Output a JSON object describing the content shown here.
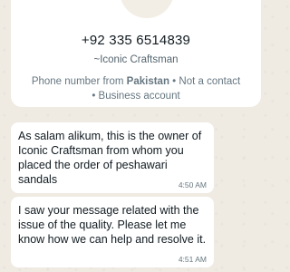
{
  "contact": {
    "phone": "+92 335 6514839",
    "push_name": "~Iconic Craftsman",
    "meta_prefix": "Phone number from ",
    "meta_country": "Pakistan",
    "meta_suffix": " • Not a contact • Business account"
  },
  "messages": [
    {
      "text": "As salam alikum, this is the owner of Iconic Craftsman from whom you placed the order of peshawari sandals",
      "time": "4:50 AM"
    },
    {
      "text": "I saw your message related with the issue of the quality. Please let me know how we can help and resolve it.",
      "time": "4:51 AM"
    }
  ],
  "colors": {
    "chat_background": "#efeae2",
    "bubble": "#ffffff",
    "primary_text": "#111b21",
    "secondary_text": "#667781"
  }
}
